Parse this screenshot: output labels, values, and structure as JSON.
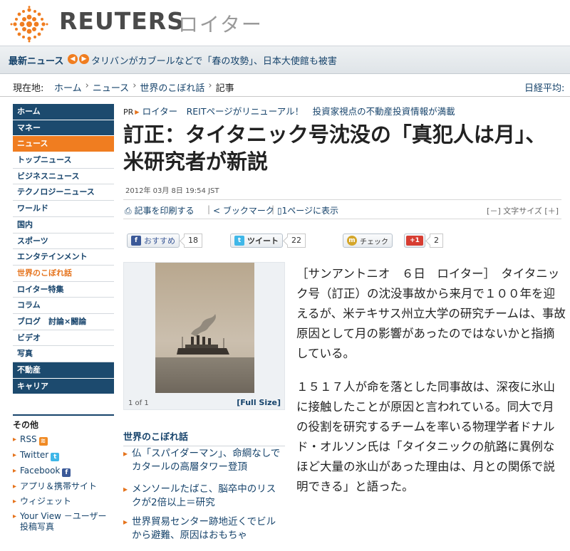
{
  "header": {
    "logo_text": "REUTERS",
    "logo_jp": "ロイター",
    "accent_color": "#f07d20",
    "navy_color": "#16436b"
  },
  "breaking": {
    "label": "最新ニュース",
    "text": "タリバンがカブールなどで「春の攻勢」、日本大使館も被害"
  },
  "breadcrumb": {
    "label": "現在地:",
    "items": [
      "ホーム",
      "ニュース",
      "世界のこぼれ話",
      "記事"
    ],
    "nikkei": "日経平均:"
  },
  "sidebar": {
    "items": [
      {
        "label": "ホーム",
        "style": "dark"
      },
      {
        "label": "マネー",
        "style": "dark"
      },
      {
        "label": "ニュース",
        "style": "active"
      },
      {
        "label": "トップニュース",
        "style": "plain"
      },
      {
        "label": "ビジネスニュース",
        "style": "plain"
      },
      {
        "label": "テクノロジーニュース",
        "style": "plain"
      },
      {
        "label": "ワールド",
        "style": "plain"
      },
      {
        "label": "国内",
        "style": "plain"
      },
      {
        "label": "スポーツ",
        "style": "plain"
      },
      {
        "label": "エンタテインメント",
        "style": "plain"
      },
      {
        "label": "世界のこぼれ話",
        "style": "orange"
      },
      {
        "label": "ロイター特集",
        "style": "plain"
      },
      {
        "label": "コラム",
        "style": "plain"
      },
      {
        "label": "ブログ　討論×闘論",
        "style": "plain"
      },
      {
        "label": "ビデオ",
        "style": "plain"
      },
      {
        "label": "写真",
        "style": "plain"
      },
      {
        "label": "不動産",
        "style": "dark"
      },
      {
        "label": "キャリア",
        "style": "dark"
      }
    ],
    "other_title": "その他",
    "other_items": [
      {
        "label": "RSS",
        "icon": "rss-icon"
      },
      {
        "label": "Twitter",
        "icon": "twitter-icon"
      },
      {
        "label": "Facebook",
        "icon": "facebook-icon"
      },
      {
        "label": "アプリ＆携帯サイト",
        "icon": ""
      },
      {
        "label": "ウィジェット",
        "icon": ""
      },
      {
        "label": "Your View －ユーザー投稿写真",
        "icon": ""
      }
    ]
  },
  "pr": {
    "tag": "PR",
    "text": "ロイター　REITページがリニューアル！　投資家視点の不動産投資情報が満載"
  },
  "article": {
    "headline": "訂正：タイタニック号沈没の「真犯人は月」、米研究者が新説",
    "date": "2012年 03月 8日 19:54 JST",
    "paragraphs": [
      "［サンアントニオ　６日　ロイター］　タイタニック号（訂正）の沈没事故から来月で１００年を迎えるが、米テキサス州立大学の研究チームは、事故原因として月の影響があったのではないかと指摘している。",
      "１５１７人が命を落とした同事故は、深夜に氷山に接触したことが原因と言われている。同大で月の役割を研究するチームを率いる物理学者ドナルド・オルソン氏は「タイタニックの航路に異例なほど大量の氷山があった理由は、月との関係で説明できる」と語った。"
    ]
  },
  "tools": {
    "print": "記事を印刷する",
    "bookmark": "ブックマーク",
    "one_page": "1ページに表示",
    "font_size": "[－] 文字サイズ [＋]"
  },
  "social": {
    "recommend_label": "おすすめ",
    "recommend_count": "18",
    "tweet_label": "ツイート",
    "tweet_count": "22",
    "check_label": "チェック",
    "gplus_label": "+1",
    "gplus_count": "2"
  },
  "photo": {
    "counter": "1 of 1",
    "full_size": "[Full Size]"
  },
  "related": {
    "title": "世界のこぼれ話",
    "items": [
      "仏「スパイダーマン」、命綱なしでカタールの高層タワー登頂",
      "メンソールたばこ、脳卒中のリスクが2倍以上＝研究",
      "世界貿易センター跡地近くでビルから避難、原因はおもちゃ"
    ]
  }
}
